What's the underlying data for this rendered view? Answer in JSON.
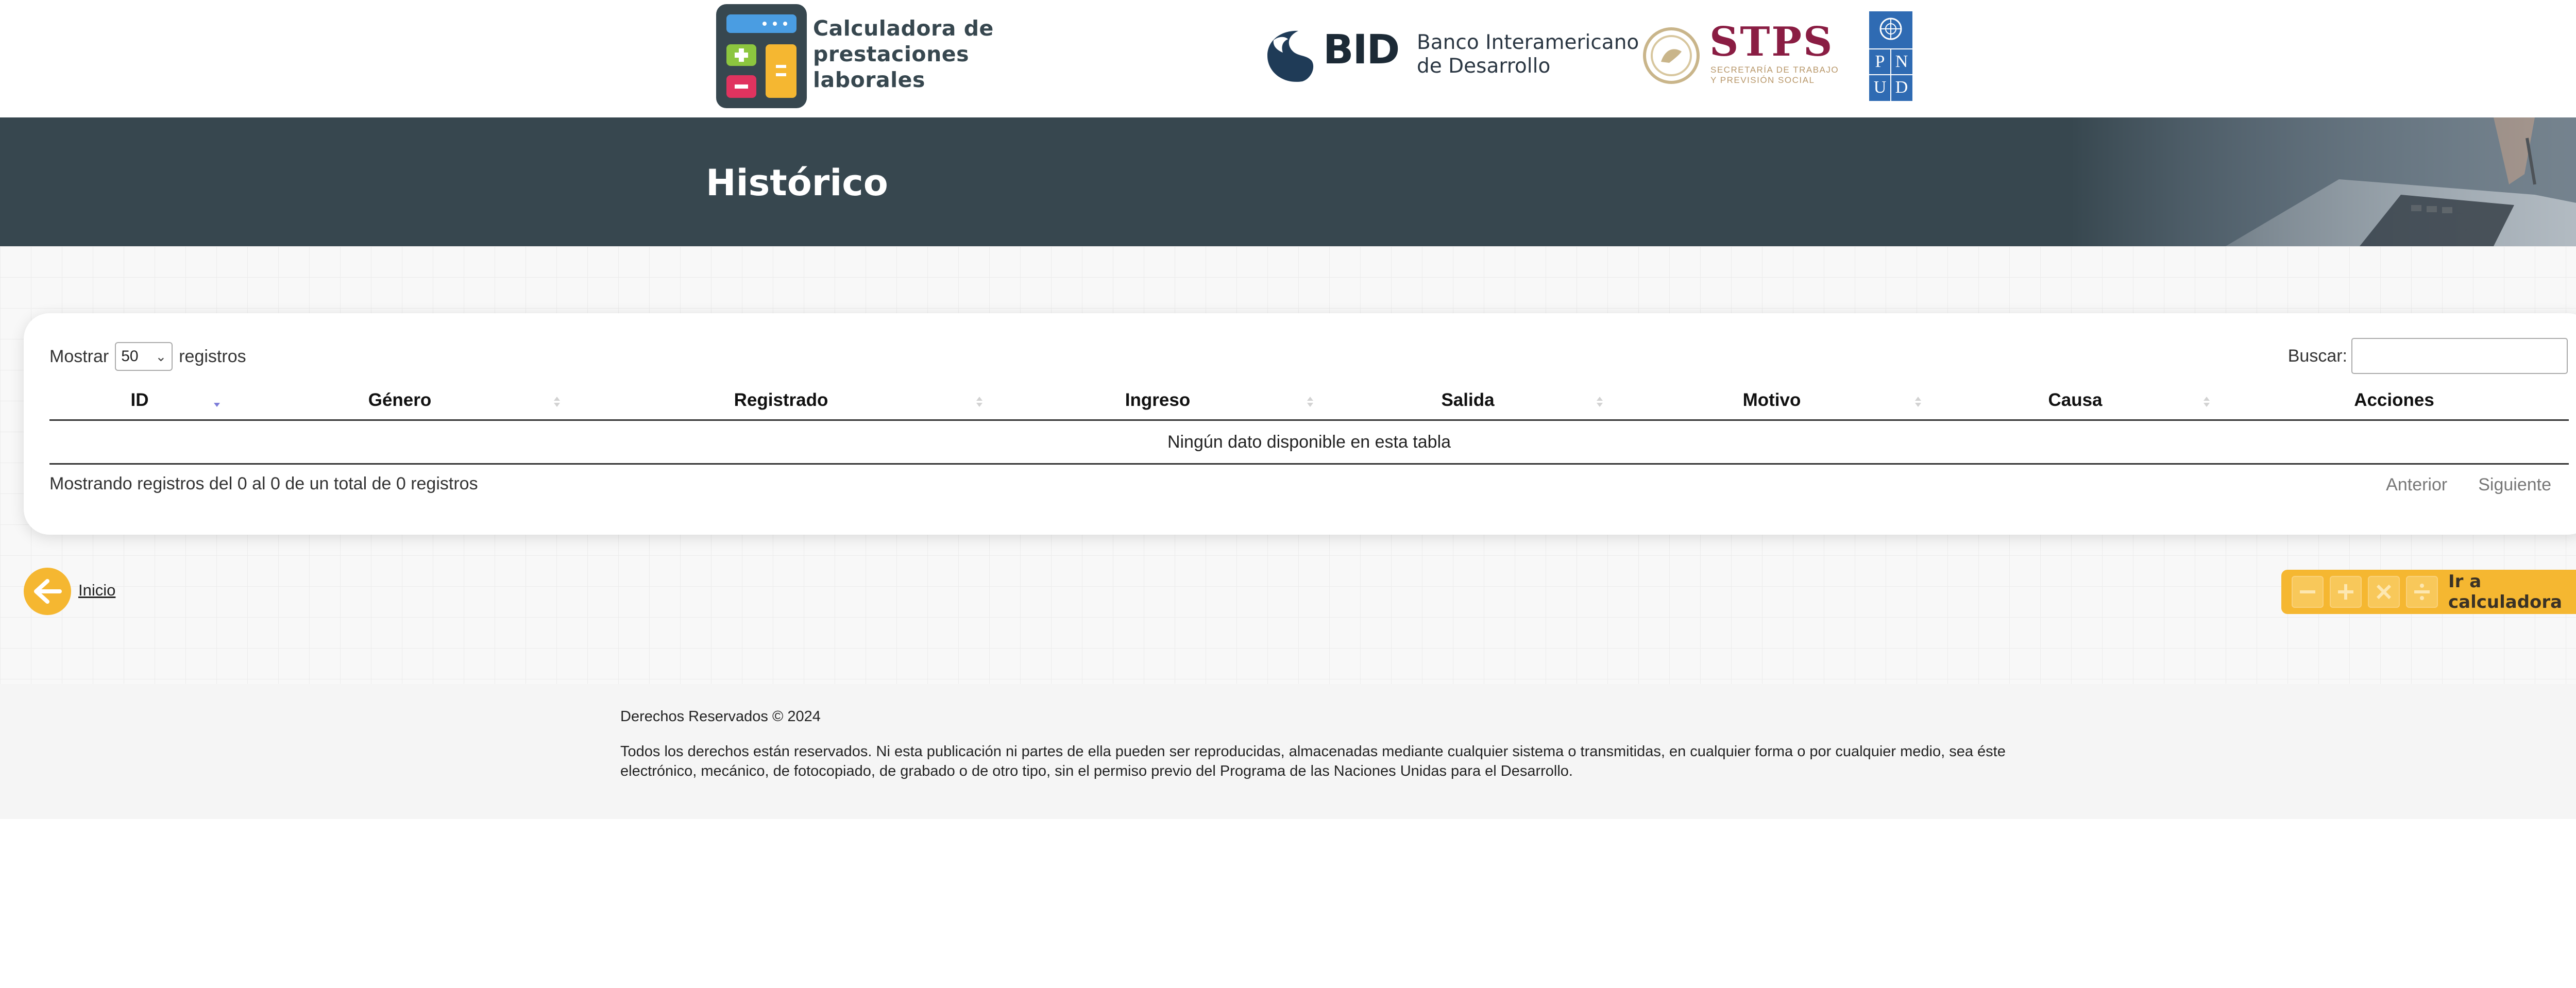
{
  "header": {
    "app_title": "Calculadora de\nprestaciones\nlaborales",
    "bid_abbrev": "BID",
    "bid_name": "Banco Interamericano\nde Desarrollo",
    "stps_abbrev": "STPS",
    "stps_subtitle": "SECRETARÍA DE TRABAJO\nY PREVISIÓN SOCIAL",
    "pnud_letters": [
      "P",
      "N",
      "U",
      "D"
    ]
  },
  "banner": {
    "title": "Histórico"
  },
  "table_controls": {
    "show_label": "Mostrar",
    "page_length": "50",
    "records_label": "registros",
    "search_label": "Buscar:",
    "search_value": ""
  },
  "table": {
    "columns": [
      "ID",
      "Género",
      "Registrado",
      "Ingreso",
      "Salida",
      "Motivo",
      "Causa",
      "Acciones"
    ],
    "empty_message": "Ningún dato disponible en esta tabla",
    "info": "Mostrando registros del 0 al 0 de un total de 0 registros",
    "prev_label": "Anterior",
    "next_label": "Siguiente"
  },
  "nav": {
    "back_label": "Inicio",
    "calc_label": "Ir a calculadora"
  },
  "footer": {
    "copyright": "Derechos Reservados © 2024",
    "legal": "Todos los derechos están reservados. Ni esta publicación ni partes de ella pueden ser reproducidas, almacenadas mediante cualquier sistema o transmitidas, en cualquier forma o por cualquier medio, sea éste electrónico, mecánico, de fotocopiado, de grabado o de otro tipo, sin el permiso previo del Programa de las Naciones Unidas para el Desarrollo."
  },
  "colors": {
    "banner": "#37474f",
    "accent": "#f5b731",
    "stps": "#8a1d43",
    "pnud": "#2f6bb3"
  }
}
